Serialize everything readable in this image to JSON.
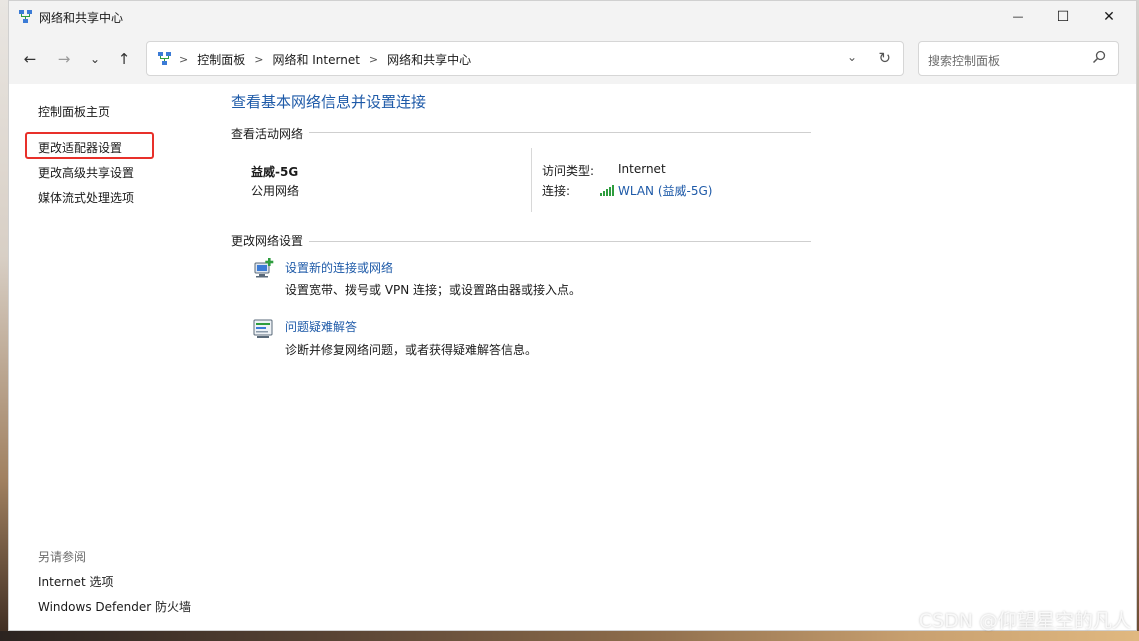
{
  "window": {
    "title": "网络和共享中心",
    "minimize_glyph": "—",
    "maximize_glyph": "☐",
    "close_glyph": "✕"
  },
  "nav": {
    "back_glyph": "←",
    "forward_glyph": "→",
    "recent_glyph": "⌄",
    "up_glyph": "↑",
    "breadcrumbs": [
      "控制面板",
      "网络和 Internet",
      "网络和共享中心"
    ],
    "dropdown_glyph": "⌄",
    "refresh_glyph": "↻",
    "search_placeholder": "搜索控制面板"
  },
  "sidebar": {
    "items": [
      {
        "label": "控制面板主页"
      },
      {
        "label": "更改适配器设置"
      },
      {
        "label": "更改高级共享设置"
      },
      {
        "label": "媒体流式处理选项"
      }
    ],
    "see_also_heading": "另请参阅",
    "see_also": [
      {
        "label": "Internet 选项"
      },
      {
        "label": "Windows Defender 防火墙"
      }
    ]
  },
  "main": {
    "title": "查看基本网络信息并设置连接",
    "active_networks_heading": "查看活动网络",
    "network": {
      "name": "益威-5G",
      "category": "公用网络",
      "access_type_label": "访问类型:",
      "access_type_value": "Internet",
      "connection_label": "连接:",
      "connection_value": "WLAN (益威-5G)"
    },
    "change_settings_heading": "更改网络设置",
    "tasks": [
      {
        "link": "设置新的连接或网络",
        "desc": "设置宽带、拨号或 VPN 连接；或设置路由器或接入点。"
      },
      {
        "link": "问题疑难解答",
        "desc": "诊断并修复网络问题，或者获得疑难解答信息。"
      }
    ]
  },
  "watermark": "CSDN @仰望星空的凡人",
  "colors": {
    "link": "#1e5aa8",
    "highlight": "#e8302a",
    "chrome": "#f3f3f3"
  }
}
